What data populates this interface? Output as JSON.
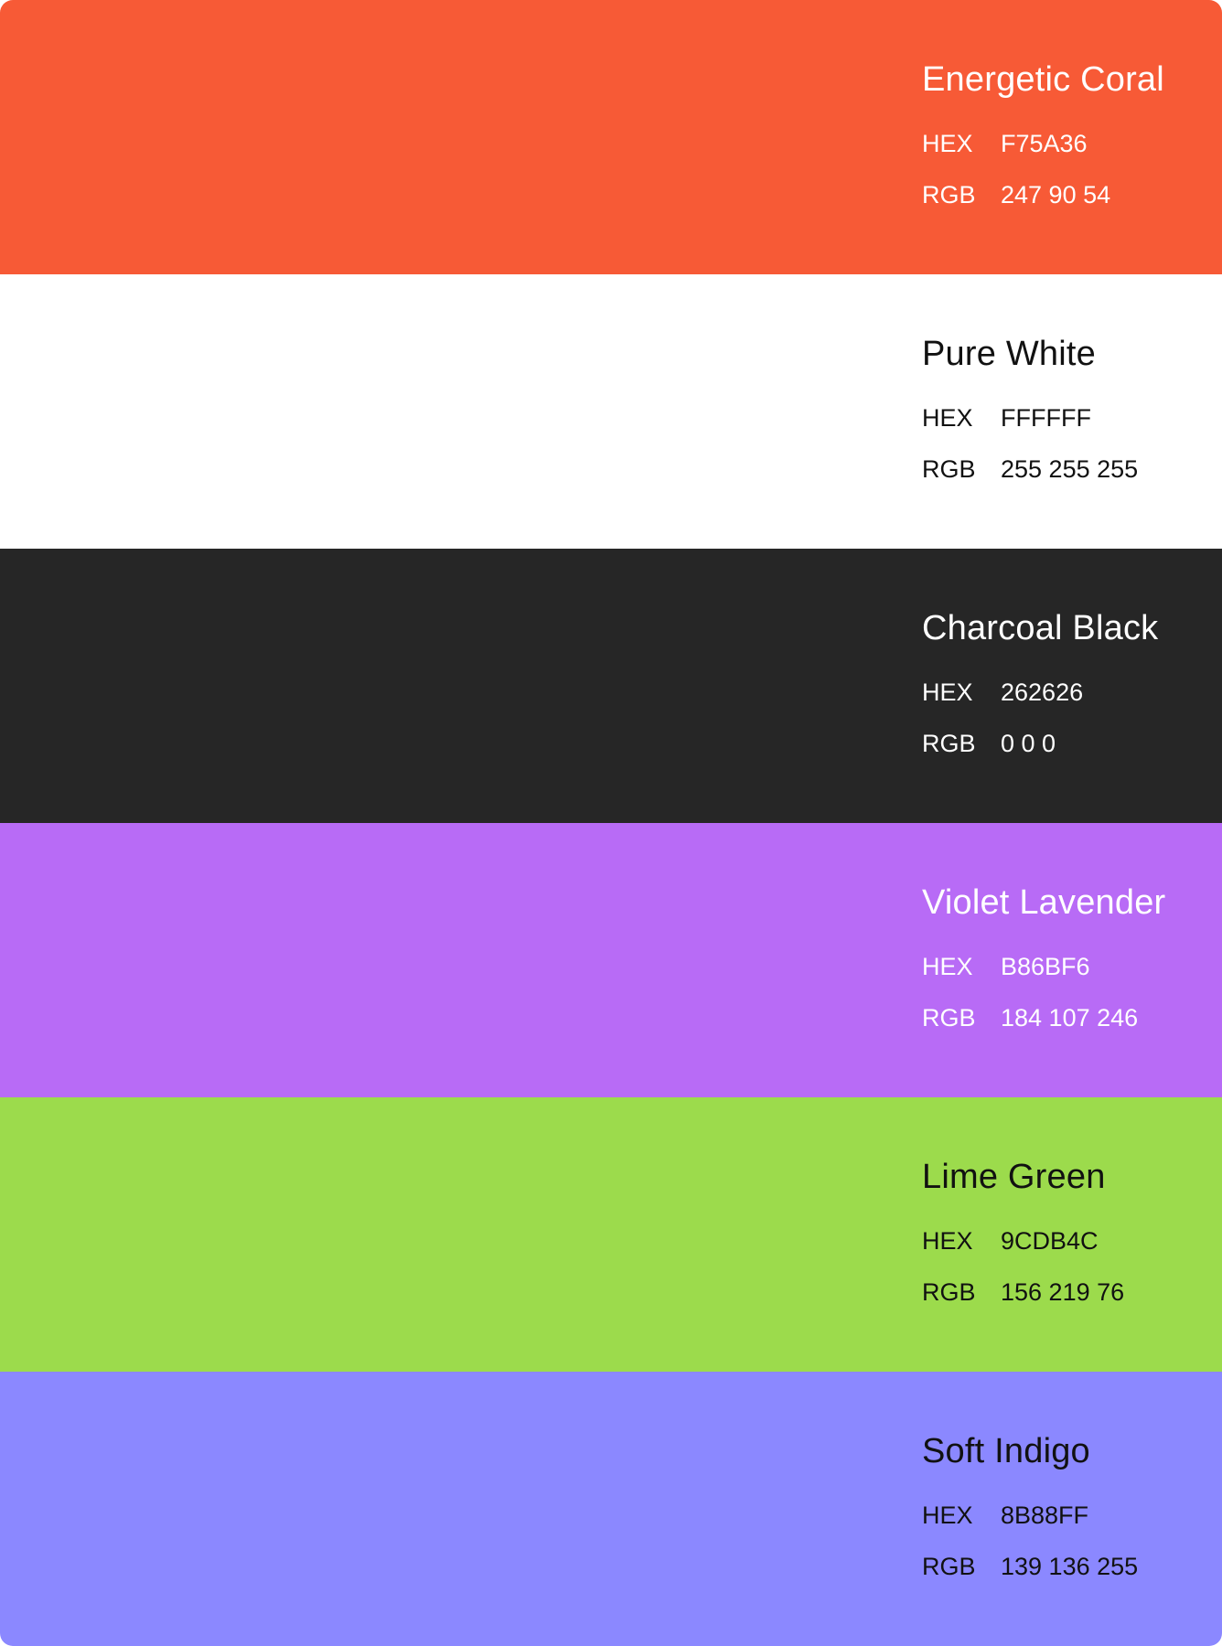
{
  "swatches": [
    {
      "name": "Energetic Coral",
      "hex_label": "HEX",
      "hex_value": "F75A36",
      "rgb_label": "RGB",
      "rgb_value": "247 90 54",
      "background": "#F75A36",
      "text_color": "#FFFFFF"
    },
    {
      "name": "Pure White",
      "hex_label": "HEX",
      "hex_value": "FFFFFF",
      "rgb_label": "RGB",
      "rgb_value": "255 255 255",
      "background": "#FFFFFF",
      "text_color": "#111111"
    },
    {
      "name": "Charcoal Black",
      "hex_label": "HEX",
      "hex_value": "262626",
      "rgb_label": "RGB",
      "rgb_value": "0 0 0",
      "background": "#262626",
      "text_color": "#FFFFFF"
    },
    {
      "name": "Violet Lavender",
      "hex_label": "HEX",
      "hex_value": "B86BF6",
      "rgb_label": "RGB",
      "rgb_value": "184 107 246",
      "background": "#B86BF6",
      "text_color": "#FFFFFF"
    },
    {
      "name": "Lime Green",
      "hex_label": "HEX",
      "hex_value": "9CDB4C",
      "rgb_label": "RGB",
      "rgb_value": "156 219 76",
      "background": "#9CDB4C",
      "text_color": "#111111"
    },
    {
      "name": "Soft Indigo",
      "hex_label": "HEX",
      "hex_value": "8B88FF",
      "rgb_label": "RGB",
      "rgb_value": "139 136 255",
      "background": "#8B88FF",
      "text_color": "#111111"
    }
  ]
}
